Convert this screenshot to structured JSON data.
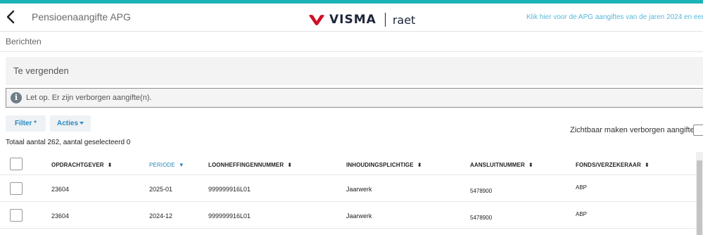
{
  "header": {
    "title": "Pensioenaangifte APG",
    "logo_text": "VISMA",
    "logo_sub": "raet",
    "apg_link": "Klik hier voor de APG aangiftes van de jaren 2024 en eerder"
  },
  "subnav": {
    "label": "Berichten"
  },
  "panel": {
    "title": "Te vergenden"
  },
  "notice": {
    "icon": "i",
    "text": "Let op. Er zijn verborgen aangifte(n)."
  },
  "toolbar": {
    "filter_label": "Filter *",
    "acties_label": "Acties",
    "visible_hidden_label": "Zichtbaar maken verborgen aangiften"
  },
  "totals": "Totaal aantal 262, aantal geselecteerd 0",
  "table": {
    "columns": [
      {
        "label": "OPDRACHTGEVER",
        "sort": "both"
      },
      {
        "label": "PERIODE",
        "sort": "desc"
      },
      {
        "label": "LOONHEFFINGENNUMMER",
        "sort": "both"
      },
      {
        "label": "INHOUDINGSPLICHTIGE",
        "sort": "both"
      },
      {
        "label": "AANSLUITNUMMER",
        "sort": "both"
      },
      {
        "label": "FONDS/VERZEKERAAR",
        "sort": "both"
      }
    ],
    "sort_icons": {
      "both": "⬍",
      "desc": "▼"
    },
    "rows": [
      {
        "opdrachtgever": "23604",
        "periode": "2025-01",
        "loonheffingennummer": "999999916L01",
        "inhoudingsplichtige": "Jaarwerk",
        "aansluitnummer": "5478900",
        "fonds": "ABP"
      },
      {
        "opdrachtgever": "23604",
        "periode": "2024-12",
        "loonheffingennummer": "999999916L01",
        "inhoudingsplichtige": "Jaarwerk",
        "aansluitnummer": "5478900",
        "fonds": "ABP"
      }
    ]
  },
  "colors": {
    "accent": "#1bb3b8",
    "link": "#2a88c0",
    "brand_red": "#d0102a",
    "brand_dark": "#1c2538"
  }
}
